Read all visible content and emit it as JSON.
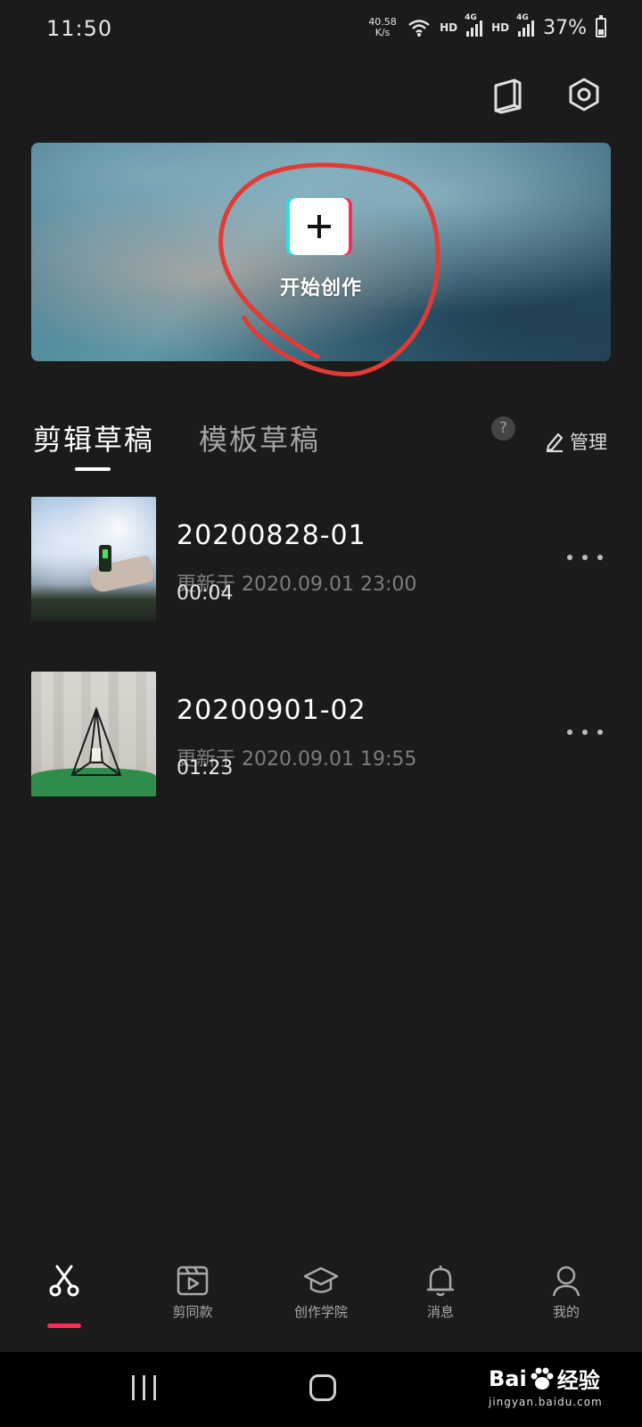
{
  "status_bar": {
    "time": "11:50",
    "net_speed_value": "40.58",
    "net_speed_unit": "K/s",
    "hd1": "HD",
    "gen1": "4G",
    "hd2": "HD",
    "gen2": "4G",
    "battery": "37%"
  },
  "top_actions": {
    "tutorial_icon": "book-icon",
    "settings_icon": "hexagon-gear-icon"
  },
  "banner": {
    "create_label": "开始创作",
    "create_icon": "plus-icon"
  },
  "tabs": {
    "items": [
      {
        "label": "剪辑草稿",
        "active": true
      },
      {
        "label": "模板草稿",
        "active": false
      }
    ],
    "help": "?",
    "manage_label": "管理"
  },
  "drafts": [
    {
      "title": "20200828-01",
      "updated": "更新于 2020.09.01 23:00",
      "duration": "00:04"
    },
    {
      "title": "20200901-02",
      "updated": "更新于 2020.09.01 19:55",
      "duration": "01:23"
    }
  ],
  "bottom_nav": {
    "items": [
      {
        "label": "",
        "icon": "scissors-icon",
        "active": true
      },
      {
        "label": "剪同款",
        "icon": "video-template-icon",
        "active": false
      },
      {
        "label": "创作学院",
        "icon": "graduation-cap-icon",
        "active": false
      },
      {
        "label": "消息",
        "icon": "bell-icon",
        "active": false
      },
      {
        "label": "我的",
        "icon": "person-icon",
        "active": false
      }
    ]
  },
  "watermark": {
    "brand_left": "Bai",
    "brand_right": "经验",
    "url": "jingyan.baidu.com"
  },
  "colors": {
    "background": "#1b1b1b",
    "accent_red": "#fe2c55",
    "accent_cyan": "#27e3e8",
    "annotation_red": "#e23b35"
  }
}
